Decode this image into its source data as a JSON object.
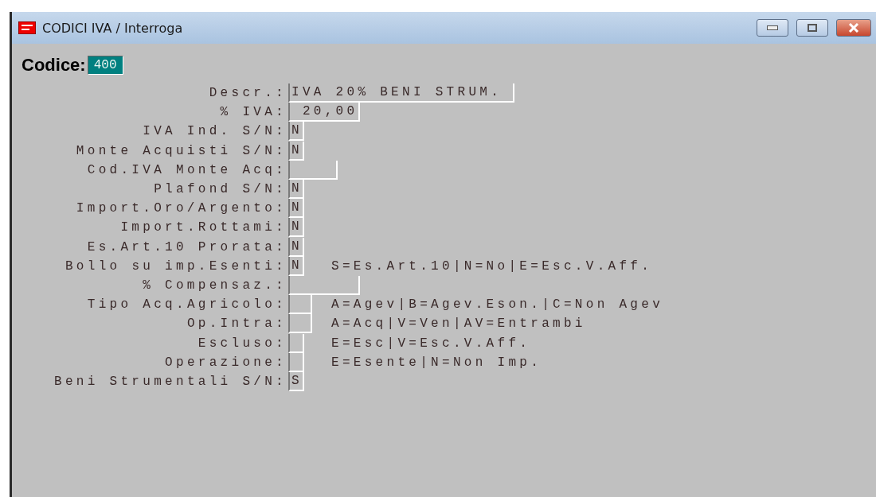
{
  "window": {
    "title": "CODICI IVA / Interroga"
  },
  "codice": {
    "label": "Codice:",
    "value": "400"
  },
  "fields": [
    {
      "label": "Descr.:",
      "value": "IVA 20% BENI STRUM.",
      "kind": "wide"
    },
    {
      "label": "% IVA:",
      "value": " 20,00",
      "kind": "amount"
    },
    {
      "label": "IVA Ind. S/N:",
      "value": "N",
      "kind": "flag"
    },
    {
      "label": "Monte Acquisti S/N:",
      "value": "N",
      "kind": "flag"
    },
    {
      "label": "Cod.IVA Monte Acq:",
      "kind": "code"
    },
    {
      "label": "Plafond S/N:",
      "value": "N",
      "kind": "flag"
    },
    {
      "label": "Import.Oro/Argento:",
      "value": "N",
      "kind": "flag"
    },
    {
      "label": "Import.Rottami:",
      "value": "N",
      "kind": "flag"
    },
    {
      "label": "Es.Art.10 Prorata:",
      "value": "N",
      "kind": "flag"
    },
    {
      "label": "Bollo su imp.Esenti:",
      "value": "N",
      "kind": "flag",
      "hint": "S=Es.Art.10|N=No|E=Esc.V.Aff."
    },
    {
      "label": "% Compensaz.:",
      "kind": "amount"
    },
    {
      "label": "Tipo Acq.Agricolo:",
      "kind": "choice",
      "hint": "A=Agev|B=Agev.Eson.|C=Non Agev"
    },
    {
      "label": "Op.Intra:",
      "kind": "choice",
      "hint": "A=Acq|V=Ven|AV=Entrambi"
    },
    {
      "label": "Escluso:",
      "kind": "flag",
      "hint": "E=Esc|V=Esc.V.Aff."
    },
    {
      "label": "Operazione:",
      "kind": "flag",
      "hint": "E=Esente|N=Non Imp."
    },
    {
      "label": "Beni Strumentali S/N:",
      "value": "S",
      "kind": "flag"
    }
  ]
}
